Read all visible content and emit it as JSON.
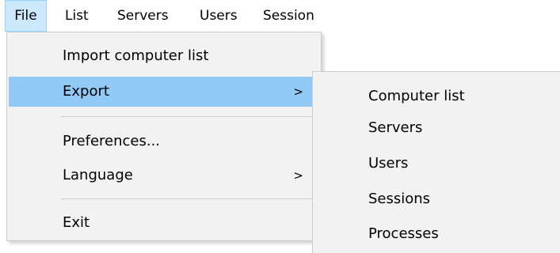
{
  "menubar": {
    "file": "File",
    "list": "List",
    "servers": "Servers",
    "users": "Users",
    "sessions": "Session"
  },
  "file_menu": {
    "import": "Import computer list",
    "export": "Export",
    "preferences": "Preferences...",
    "language": "Language",
    "exit": "Exit",
    "submenu_arrow": ">"
  },
  "export_submenu": {
    "items": [
      "Computer list",
      "Servers",
      "Users",
      "Sessions",
      "Processes"
    ]
  },
  "colors": {
    "menu_background": "#f2f2f2",
    "highlight": "#91c9f7",
    "active_menubar": "#cce8ff"
  }
}
